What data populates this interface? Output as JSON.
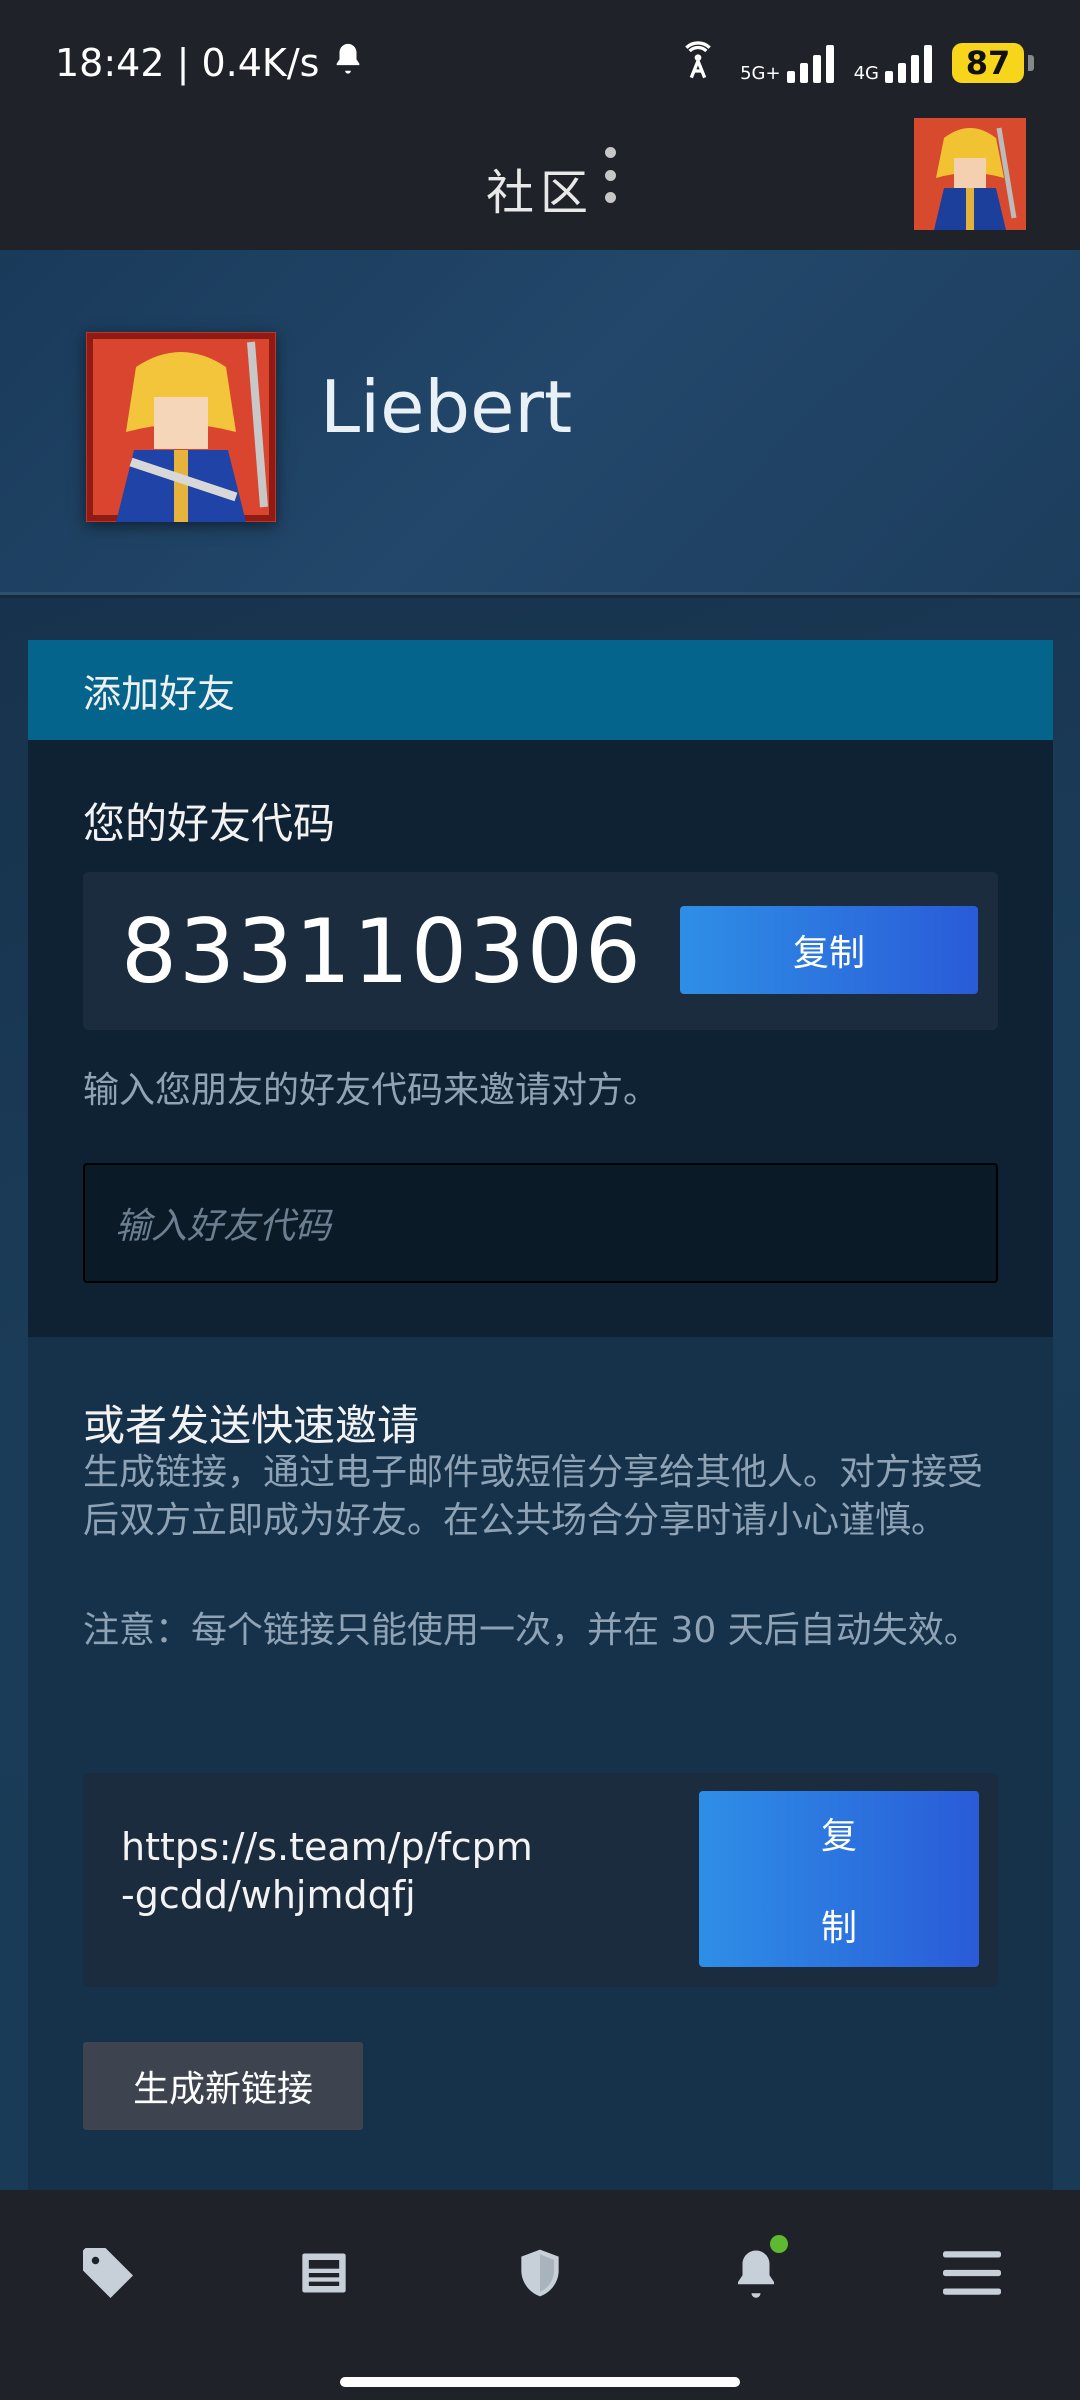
{
  "status_bar": {
    "time_speed": "18:42 | 0.4K/s",
    "network_5g": "5G+",
    "network_4g": "4G",
    "battery": "87"
  },
  "header": {
    "title": "社区"
  },
  "profile": {
    "name": "Liebert"
  },
  "add_friend": {
    "header": "添加好友",
    "your_code_label": "您的好友代码",
    "friend_code": "833110306",
    "copy_label": "复制",
    "invite_hint": "输入您朋友的好友代码来邀请对方。",
    "code_input_placeholder": "输入好友代码"
  },
  "quick_invite": {
    "title": "或者发送快速邀请",
    "description": "生成链接，通过电子邮件或短信分享给其他人。对方接受后双方立即成为好友。在公共场合分享时请小心谨慎。",
    "note": "注意：每个链接只能使用一次，并在 30 天后自动失效。",
    "link": "https://s.team/p/fcpm-gcdd/whjmdqfj",
    "copy_label_line1": "复",
    "copy_label_line2": "制",
    "generate_label": "生成新链接"
  },
  "bottom_nav": {
    "items": [
      {
        "icon": "tag-icon"
      },
      {
        "icon": "news-icon"
      },
      {
        "icon": "shield-icon"
      },
      {
        "icon": "bell-icon"
      },
      {
        "icon": "menu-icon"
      }
    ],
    "notification_color": "#5cb931"
  }
}
